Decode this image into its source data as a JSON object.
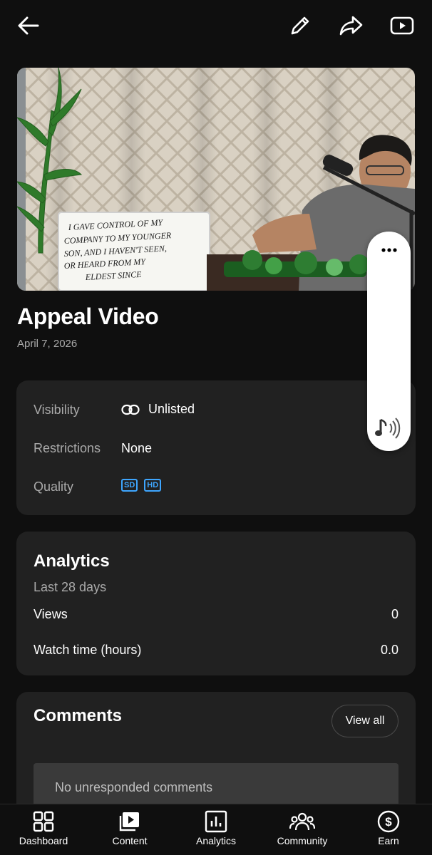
{
  "header": {
    "back_icon": "arrow-left-icon",
    "edit_icon": "pencil-icon",
    "share_icon": "share-icon",
    "youtube_icon": "youtube-play-icon"
  },
  "video": {
    "title": "Appeal Video",
    "date": "April 7, 2026",
    "whiteboard_text": [
      "I GAVE CONTROL OF MY",
      "COMPANY TO MY YOUNGER",
      "SON, AND I HAVEN'T SEEN,",
      "OR HEARD FROM MY",
      "ELDEST SINCE"
    ]
  },
  "details": {
    "visibility_label": "Visibility",
    "visibility_value": "Unlisted",
    "restrictions_label": "Restrictions",
    "restrictions_value": "None",
    "quality_label": "Quality",
    "quality_badges": [
      "SD",
      "HD"
    ]
  },
  "analytics": {
    "title": "Analytics",
    "period": "Last 28 days",
    "views_label": "Views",
    "views_value": "0",
    "watch_label": "Watch time (hours)",
    "watch_value": "0.0"
  },
  "comments": {
    "title": "Comments",
    "view_all": "View all",
    "empty_text": "No unresponded comments"
  },
  "bottom_nav": {
    "dashboard": "Dashboard",
    "content": "Content",
    "analytics": "Analytics",
    "community": "Community",
    "earn": "Earn"
  },
  "colors": {
    "background": "#0f0f0f",
    "card": "#212121",
    "accent_blue": "#3ea6ff",
    "muted_text": "#aaaaaa"
  }
}
